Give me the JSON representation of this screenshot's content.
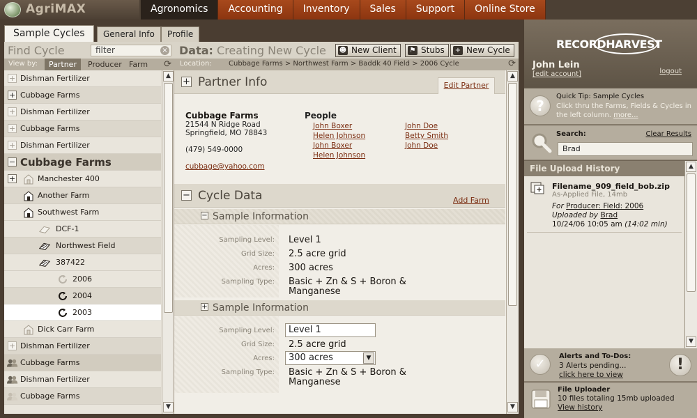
{
  "app": {
    "name": "AgriMAX"
  },
  "nav": {
    "items": [
      "Agronomics",
      "Accounting",
      "Inventory",
      "Sales",
      "Support",
      "Online Store"
    ],
    "active": "Agronomics"
  },
  "tabs": [
    "Sample Cycles",
    "General Info",
    "Profile"
  ],
  "left": {
    "find_label": "Find Cycle",
    "filter_value": "filter",
    "view_by_label": "View by:",
    "view_by": [
      "Partner",
      "Producer",
      "Farm"
    ],
    "tree": [
      {
        "label": "Dishman Fertilizer",
        "kind": "collapsed"
      },
      {
        "label": "Cubbage Farms",
        "kind": "collapsed-dark"
      },
      {
        "label": "Dishman Fertilizer",
        "kind": "collapsed"
      },
      {
        "label": "Cubbage Farms",
        "kind": "collapsed"
      },
      {
        "label": "Dishman Fertilizer",
        "kind": "collapsed"
      },
      {
        "label": "Cubbage Farms",
        "kind": "expanded"
      },
      {
        "label": "Manchester 400",
        "kind": "farm-collapsed"
      },
      {
        "label": "Another Farm",
        "kind": "farm"
      },
      {
        "label": "Southwest Farm",
        "kind": "farm-open"
      },
      {
        "label": "DCF-1",
        "kind": "field-light"
      },
      {
        "label": "Northwest Field",
        "kind": "field"
      },
      {
        "label": "387422",
        "kind": "field"
      },
      {
        "label": "2006",
        "kind": "cycle-light"
      },
      {
        "label": "2004",
        "kind": "cycle"
      },
      {
        "label": "2003",
        "kind": "cycle-selected"
      },
      {
        "label": "Dick Carr Farm",
        "kind": "farm"
      },
      {
        "label": "Dishman Fertilizer",
        "kind": "collapsed"
      },
      {
        "label": "Cubbage Farms",
        "kind": "people"
      },
      {
        "label": "Dishman Fertilizer",
        "kind": "people"
      },
      {
        "label": "Cubbage Farms",
        "kind": "people-light"
      }
    ]
  },
  "center": {
    "title_prefix": "Data:",
    "title": "Creating New Cycle",
    "buttons": {
      "new_client": "New Client",
      "stubs": "Stubs",
      "new_cycle": "New Cycle"
    },
    "location_label": "Location:",
    "location_path": "Cubbage Farms > Northwest Farm > Baddk 40 Field > 2006 Cycle",
    "partner": {
      "heading": "Partner Info",
      "edit": "Edit Partner",
      "name": "Cubbage Farms",
      "street": "21544 N Ridge Road",
      "city": "Springfield, MO 78843",
      "phone": "(479) 549-0000",
      "email": "cubbage@yahoo.com",
      "people_label": "People",
      "people_col1": [
        "John Boxer",
        "Helen Johnson",
        "John Boxer",
        "Helen Johnson"
      ],
      "people_col2": [
        "John Doe",
        "Betty Smith",
        "John Doe"
      ]
    },
    "cycle": {
      "heading": "Cycle Data",
      "add": "Add Farm",
      "sample1": {
        "heading": "Sample Information",
        "labels": [
          "Sampling Level:",
          "Grid Size:",
          "Acres:",
          "Sampling Type:"
        ],
        "level": "Level 1",
        "grid": "2.5 acre grid",
        "acres": "300 acres",
        "type_line1": "Basic + Zn & S + Boron &",
        "type_line2": "Manganese"
      },
      "sample2": {
        "heading": "Sample Information",
        "labels": [
          "Sampling Level:",
          "Grid Size:",
          "Acres:",
          "Sampling Type:"
        ],
        "level": "Level 1",
        "grid": "2.5 acre grid",
        "acres": "300 acres",
        "type_line1": "Basic + Zn & S + Boron &",
        "type_line2": "Manganese"
      }
    }
  },
  "right": {
    "brand": "RECORDHARVEST",
    "user": "John Lein",
    "edit_account": "[edit account]",
    "logout": "logout",
    "tip_heading": "Quick Tip:  Sample Cycles",
    "tip_body": "Click thru the Farms, Fields & Cycles in the left column.",
    "tip_more": "more...",
    "search_label": "Search:",
    "search_clear": "Clear Results",
    "search_value": "Brad",
    "upload_history_heading": "File Upload History",
    "upload": {
      "filename": "Filename_909_field_bob.zip",
      "filetype": "As-Applied File, 14mb",
      "for_label": "For",
      "for_link": "Producer: Field: 2006",
      "by_label": "Uploaded by",
      "by_link": "Brad",
      "date": "10/24/06 10:05 am",
      "time": "(14:02 min)"
    },
    "alerts_heading": "Alerts and To-Dos:",
    "alerts_body": "3 Alerts pending...",
    "alerts_link": "click here to view",
    "uploader_heading": "File Uploader",
    "uploader_body": "10 files totaling 15mb uploaded",
    "uploader_link": "View history"
  }
}
